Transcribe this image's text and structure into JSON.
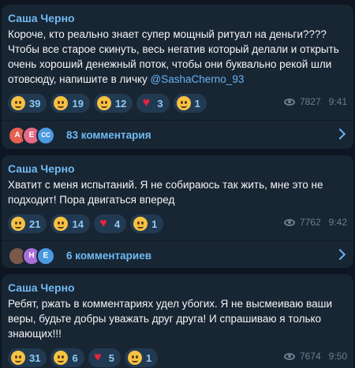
{
  "posts": [
    {
      "author": "Саша Черно",
      "text_before": "Короче, кто реально знает супер мощный ритуал на деньги???? Чтобы все старое скинуть, весь негатив который делали и открыть очень хороший денежный поток, чтобы они буквально рекой шли отовсюду, напишите в личку ",
      "mention": "@SashaCherno_93",
      "reactions": [
        {
          "emoji": "hug-face",
          "count": "39"
        },
        {
          "emoji": "thinking-face",
          "count": "19"
        },
        {
          "emoji": "screaming-face",
          "count": "12"
        },
        {
          "emoji": "heart",
          "count": "3"
        },
        {
          "emoji": "sad-face",
          "count": "1"
        }
      ],
      "views": "7827",
      "time": "9:41",
      "comments": {
        "avatars": [
          "А",
          "Е",
          "СС"
        ],
        "label": "83 комментария"
      }
    },
    {
      "author": "Саша Черно",
      "text_before": "Хватит с меня испытаний. Я не собираюсь так жить, мне это не подходит! Пора двигаться вперед",
      "mention": "",
      "reactions": [
        {
          "emoji": "screaming-face",
          "count": "21"
        },
        {
          "emoji": "hug-face",
          "count": "14"
        },
        {
          "emoji": "heart",
          "count": "4"
        },
        {
          "emoji": "thinking-face",
          "count": "1"
        }
      ],
      "views": "7762",
      "time": "9:42",
      "comments": {
        "avatars": [
          "",
          "Н",
          "Е"
        ],
        "label": "6 комментариев"
      }
    },
    {
      "author": "Саша Черно",
      "text_before": "Ребят, ржать в комментариях удел убогих. Я не высмеиваю ваши веры, будьте добры уважать друг друга! И спрашиваю я только знающих!!!",
      "mention": "",
      "reactions": [
        {
          "emoji": "hug-face",
          "count": "31"
        },
        {
          "emoji": "screaming-face",
          "count": "6"
        },
        {
          "emoji": "heart",
          "count": "5"
        },
        {
          "emoji": "sad-face",
          "count": "1"
        }
      ],
      "views": "7674",
      "time": "9:50"
    }
  ],
  "colors": {
    "background": "#0e1621",
    "bubble": "#182533",
    "author": "#71baf2",
    "reaction_bg": "#223a51",
    "heart": "#e8223e"
  }
}
